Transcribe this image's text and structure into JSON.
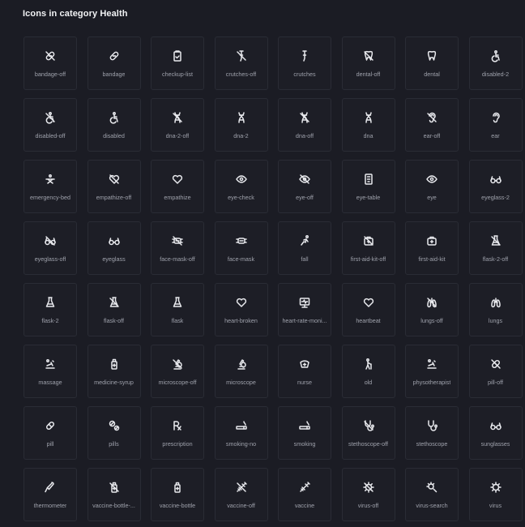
{
  "page": {
    "title": "Icons in category Health"
  },
  "icons": [
    {
      "label": "bandage-off",
      "icon": "bandage-off-icon"
    },
    {
      "label": "bandage",
      "icon": "bandage-icon"
    },
    {
      "label": "checkup-list",
      "icon": "checkup-list-icon"
    },
    {
      "label": "crutches-off",
      "icon": "crutches-off-icon"
    },
    {
      "label": "crutches",
      "icon": "crutches-icon"
    },
    {
      "label": "dental-off",
      "icon": "dental-off-icon"
    },
    {
      "label": "dental",
      "icon": "dental-icon"
    },
    {
      "label": "disabled-2",
      "icon": "disabled-2-icon"
    },
    {
      "label": "disabled-off",
      "icon": "disabled-off-icon"
    },
    {
      "label": "disabled",
      "icon": "disabled-icon"
    },
    {
      "label": "dna-2-off",
      "icon": "dna-2-off-icon"
    },
    {
      "label": "dna-2",
      "icon": "dna-2-icon"
    },
    {
      "label": "dna-off",
      "icon": "dna-off-icon"
    },
    {
      "label": "dna",
      "icon": "dna-icon"
    },
    {
      "label": "ear-off",
      "icon": "ear-off-icon"
    },
    {
      "label": "ear",
      "icon": "ear-icon"
    },
    {
      "label": "emergency-bed",
      "icon": "emergency-bed-icon"
    },
    {
      "label": "empathize-off",
      "icon": "empathize-off-icon"
    },
    {
      "label": "empathize",
      "icon": "empathize-icon"
    },
    {
      "label": "eye-check",
      "icon": "eye-check-icon"
    },
    {
      "label": "eye-off",
      "icon": "eye-off-icon"
    },
    {
      "label": "eye-table",
      "icon": "eye-table-icon"
    },
    {
      "label": "eye",
      "icon": "eye-icon"
    },
    {
      "label": "eyeglass-2",
      "icon": "eyeglass-2-icon"
    },
    {
      "label": "eyeglass-off",
      "icon": "eyeglass-off-icon"
    },
    {
      "label": "eyeglass",
      "icon": "eyeglass-icon"
    },
    {
      "label": "face-mask-off",
      "icon": "face-mask-off-icon"
    },
    {
      "label": "face-mask",
      "icon": "face-mask-icon"
    },
    {
      "label": "fall",
      "icon": "fall-icon"
    },
    {
      "label": "first-aid-kit-off",
      "icon": "first-aid-kit-off-icon"
    },
    {
      "label": "first-aid-kit",
      "icon": "first-aid-kit-icon"
    },
    {
      "label": "flask-2-off",
      "icon": "flask-2-off-icon"
    },
    {
      "label": "flask-2",
      "icon": "flask-2-icon"
    },
    {
      "label": "flask-off",
      "icon": "flask-off-icon"
    },
    {
      "label": "flask",
      "icon": "flask-icon"
    },
    {
      "label": "heart-broken",
      "icon": "heart-broken-icon"
    },
    {
      "label": "heart-rate-moni...",
      "icon": "heart-rate-monitor-icon"
    },
    {
      "label": "heartbeat",
      "icon": "heartbeat-icon"
    },
    {
      "label": "lungs-off",
      "icon": "lungs-off-icon"
    },
    {
      "label": "lungs",
      "icon": "lungs-icon"
    },
    {
      "label": "massage",
      "icon": "massage-icon"
    },
    {
      "label": "medicine-syrup",
      "icon": "medicine-syrup-icon"
    },
    {
      "label": "microscope-off",
      "icon": "microscope-off-icon"
    },
    {
      "label": "microscope",
      "icon": "microscope-icon"
    },
    {
      "label": "nurse",
      "icon": "nurse-icon"
    },
    {
      "label": "old",
      "icon": "old-icon"
    },
    {
      "label": "physotherapist",
      "icon": "physotherapist-icon"
    },
    {
      "label": "pill-off",
      "icon": "pill-off-icon"
    },
    {
      "label": "pill",
      "icon": "pill-icon"
    },
    {
      "label": "pills",
      "icon": "pills-icon"
    },
    {
      "label": "prescription",
      "icon": "prescription-icon"
    },
    {
      "label": "smoking-no",
      "icon": "smoking-no-icon"
    },
    {
      "label": "smoking",
      "icon": "smoking-icon"
    },
    {
      "label": "stethoscope-off",
      "icon": "stethoscope-off-icon"
    },
    {
      "label": "stethoscope",
      "icon": "stethoscope-icon"
    },
    {
      "label": "sunglasses",
      "icon": "sunglasses-icon"
    },
    {
      "label": "thermometer",
      "icon": "thermometer-icon"
    },
    {
      "label": "vaccine-bottle-...",
      "icon": "vaccine-bottle-off-icon"
    },
    {
      "label": "vaccine-bottle",
      "icon": "vaccine-bottle-icon"
    },
    {
      "label": "vaccine-off",
      "icon": "vaccine-off-icon"
    },
    {
      "label": "vaccine",
      "icon": "vaccine-icon"
    },
    {
      "label": "virus-off",
      "icon": "virus-off-icon"
    },
    {
      "label": "virus-search",
      "icon": "virus-search-icon"
    },
    {
      "label": "virus",
      "icon": "virus-icon"
    }
  ],
  "colors": {
    "background": "#1b1c24",
    "tile_border": "#2a2c35",
    "icon": "#e9eaee",
    "label": "#9fa2ac"
  }
}
